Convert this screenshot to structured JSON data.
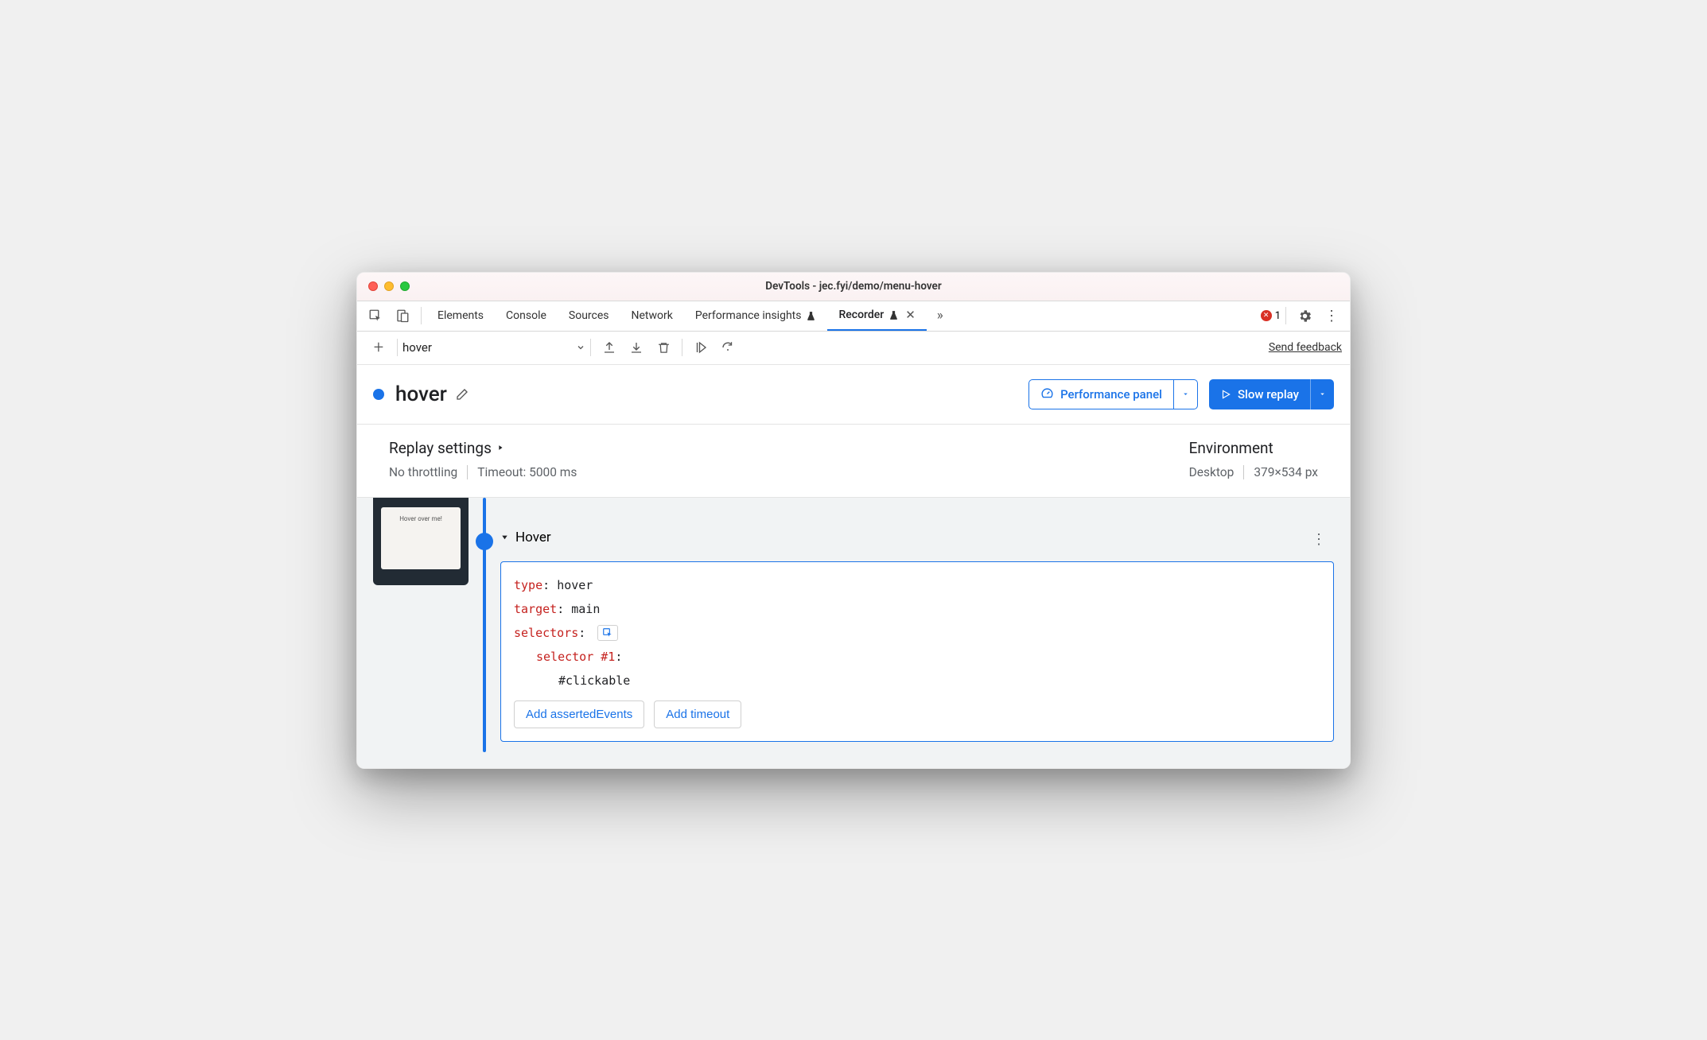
{
  "window": {
    "title": "DevTools - jec.fyi/demo/menu-hover"
  },
  "tabs": {
    "elements": "Elements",
    "console": "Console",
    "sources": "Sources",
    "network": "Network",
    "performance_insights": "Performance insights",
    "recorder": "Recorder"
  },
  "errors": {
    "count": "1"
  },
  "toolbar": {
    "recording_name": "hover",
    "send_feedback": "Send feedback"
  },
  "header": {
    "title": "hover",
    "performance_panel": "Performance panel",
    "slow_replay": "Slow replay"
  },
  "settings": {
    "replay_heading": "Replay settings",
    "throttling": "No throttling",
    "timeout": "Timeout: 5000 ms",
    "env_heading": "Environment",
    "device": "Desktop",
    "viewport": "379×534 px"
  },
  "thumbnail": {
    "label": "Hover over me!"
  },
  "step": {
    "title": "Hover",
    "type_key": "type",
    "type_val": "hover",
    "target_key": "target",
    "target_val": "main",
    "selectors_key": "selectors",
    "selector1_key": "selector #1",
    "selector1_val": "#clickable",
    "add_asserted": "Add assertedEvents",
    "add_timeout": "Add timeout"
  }
}
